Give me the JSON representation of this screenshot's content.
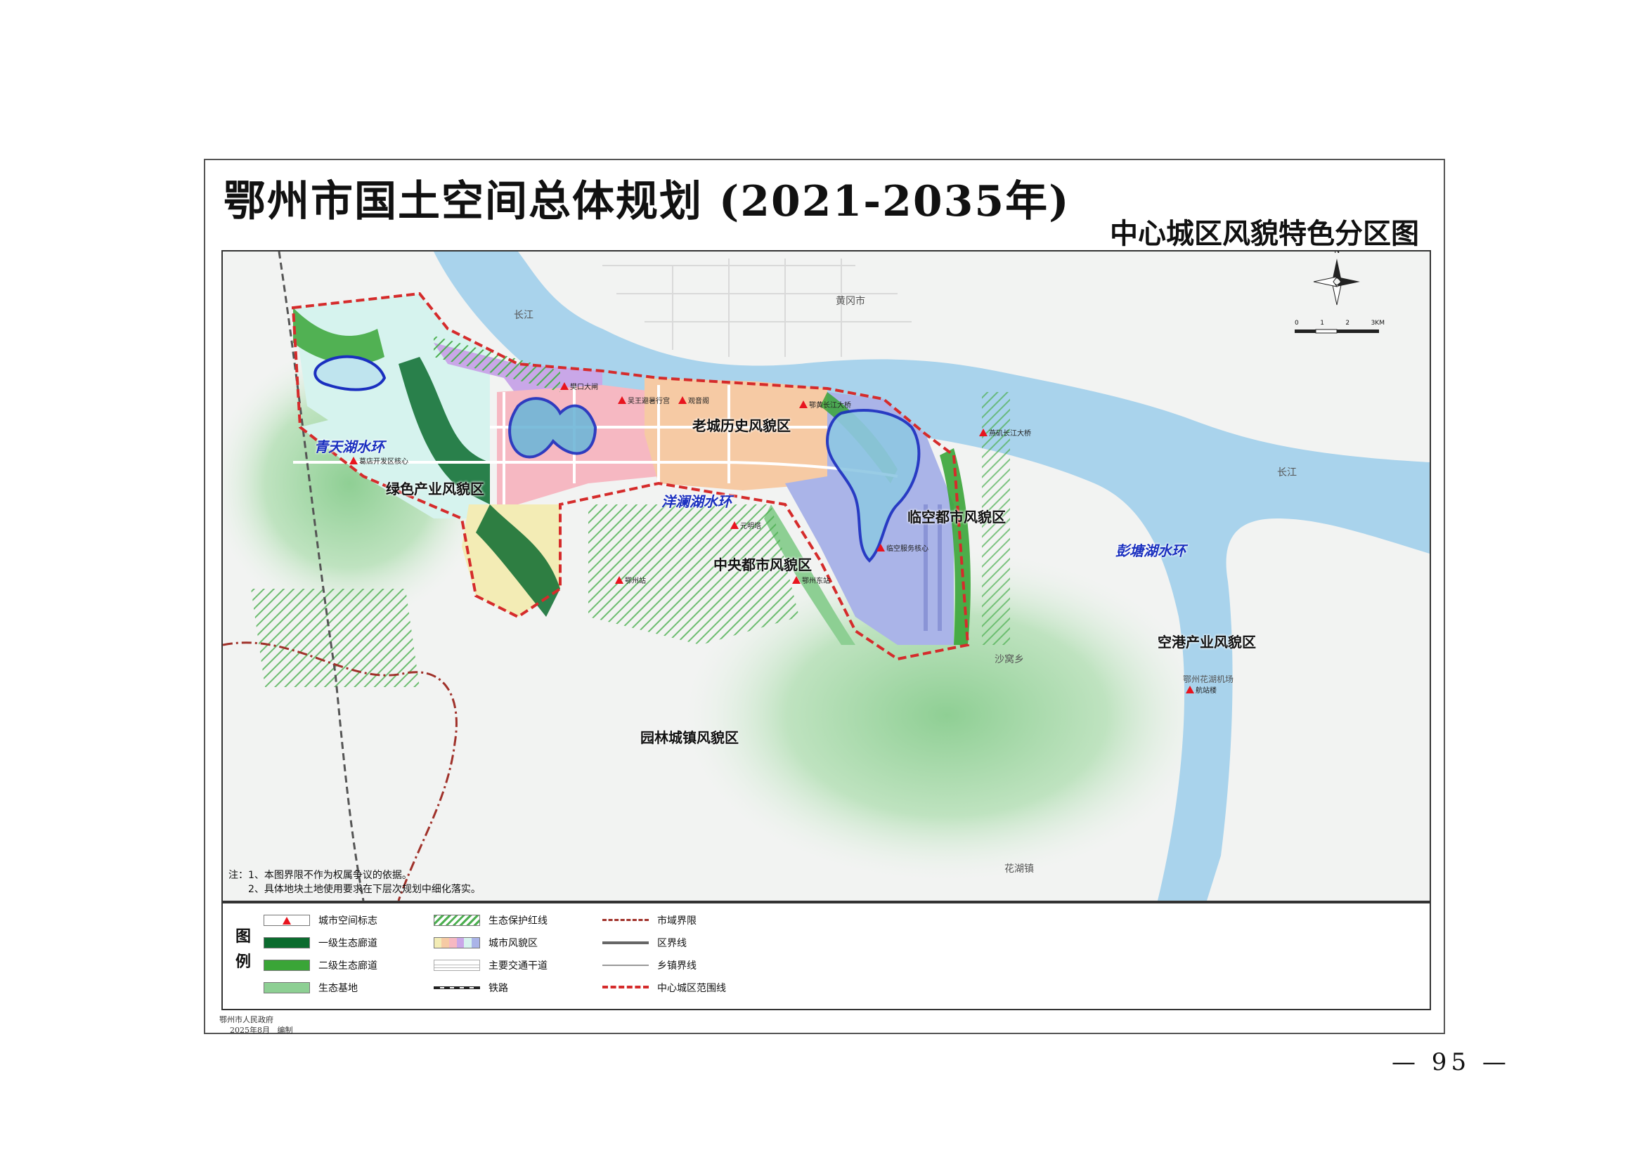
{
  "title": "鄂州市国土空间总体规划 (2021-2035年)",
  "subtitle": "中心城区风貌特色分区图",
  "zones": [
    {
      "id": "green-industry",
      "label": "绿色产业风貌区"
    },
    {
      "id": "old-city",
      "label": "老城历史风貌区"
    },
    {
      "id": "central-urban",
      "label": "中央都市风貌区"
    },
    {
      "id": "airport-urban",
      "label": "临空都市风貌区"
    },
    {
      "id": "airport-industry",
      "label": "空港产业风貌区"
    },
    {
      "id": "garden-town",
      "label": "园林城镇风貌区"
    }
  ],
  "water_rings": [
    {
      "id": "qingtian",
      "label": "青天湖水环"
    },
    {
      "id": "yanglan",
      "label": "洋澜湖水环"
    },
    {
      "id": "pengtang",
      "label": "彭塘湖水环"
    }
  ],
  "place_labels": [
    "黄冈市",
    "长江",
    "沙窝乡",
    "花湖镇",
    "长江"
  ],
  "landmarks": [
    {
      "id": "gedian-core",
      "label": "葛店开发区核心"
    },
    {
      "id": "ezhou-station",
      "label": "鄂州站"
    },
    {
      "id": "ezhou-east",
      "label": "鄂州东站"
    },
    {
      "id": "lingkong-core",
      "label": "临空服务核心"
    },
    {
      "id": "airport-terminal",
      "label": "航站楼"
    },
    {
      "id": "yuanming-tower",
      "label": "元明塔"
    },
    {
      "id": "fankou-gate",
      "label": "樊口大闸"
    },
    {
      "id": "wuwang",
      "label": "吴王避暑行宫"
    },
    {
      "id": "guanyin",
      "label": "观音阁"
    },
    {
      "id": "ehuang-bridge",
      "label": "鄂黄长江大桥"
    },
    {
      "id": "ehang-bridge",
      "label": "燕矶长江大桥"
    }
  ],
  "airport_label": "鄂州花湖机场",
  "compass_label": "N",
  "scale": {
    "ticks": [
      "0",
      "1",
      "2",
      "3KM"
    ]
  },
  "notes": [
    "注：1、本图界限不作为权属争议的依据。",
    "2、具体地块土地使用要求在下层次规划中细化落实。"
  ],
  "legend": {
    "title": "图例",
    "items": [
      {
        "label": "城市空间标志",
        "kind": "landmark"
      },
      {
        "label": "一级生态廊道",
        "kind": "fill",
        "color": "#0b6b2e"
      },
      {
        "label": "二级生态廊道",
        "kind": "fill",
        "color": "#3aa537"
      },
      {
        "label": "生态基地",
        "kind": "fill",
        "color": "#8dcf93"
      },
      {
        "label": "生态保护红线",
        "kind": "hatch",
        "color": "#4caf50"
      },
      {
        "label": "城市风貌区",
        "kind": "multi"
      },
      {
        "label": "主要交通干道",
        "kind": "road"
      },
      {
        "label": "铁路",
        "kind": "rail"
      },
      {
        "label": "市域界限",
        "kind": "boundary-city",
        "color": "#a0312a"
      },
      {
        "label": "区界线",
        "kind": "boundary-district",
        "color": "#666666"
      },
      {
        "label": "乡镇界线",
        "kind": "boundary-town",
        "color": "#999999"
      },
      {
        "label": "中心城区范围线",
        "kind": "boundary-center",
        "color": "#d52b2b"
      }
    ]
  },
  "editor": {
    "org": "鄂州市人民政府",
    "date": "2025年8月",
    "action": "编制"
  },
  "page_number": "— 95 —",
  "colors": {
    "river": "#a9d3ec",
    "green_industry": "#d6f3ee",
    "old_city": "#c9a7e8",
    "central_urban": "#f6b8c2",
    "airport_urban": "#f6caa4",
    "airport_industry": "#aab4e8",
    "garden_town": "#f3ecb5",
    "eco_base": "#8dcf93",
    "corridor_1": "#0b6b2e",
    "corridor_2": "#3aa537",
    "boundary": "#d52b2b",
    "ring": "#1a2fbf"
  }
}
